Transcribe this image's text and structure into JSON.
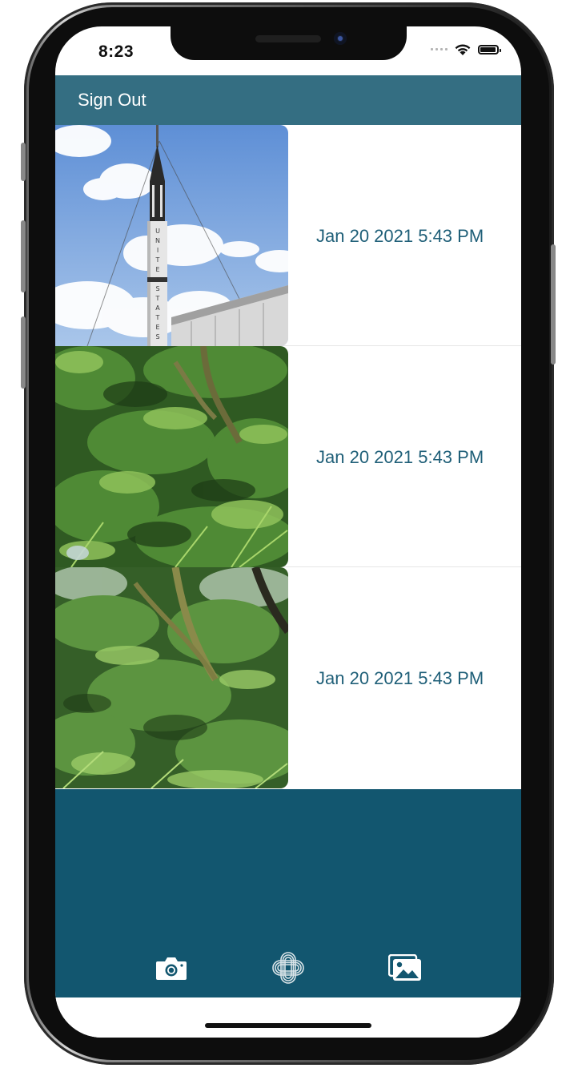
{
  "status_bar": {
    "time": "8:23",
    "icons": [
      "signal-icon",
      "wifi-icon",
      "battery-icon"
    ]
  },
  "header": {
    "sign_out_label": "Sign Out",
    "color": "#346e82"
  },
  "photos": [
    {
      "date": "Jan 20 2021 5:43 PM",
      "thumbnail": "rocket-photo"
    },
    {
      "date": "Jan 20 2021 5:43 PM",
      "thumbnail": "forest-photo"
    },
    {
      "date": "Jan 20 2021 5:43 PM",
      "thumbnail": "forest-photo"
    }
  ],
  "tab_bar": {
    "color": "#12566f",
    "items": [
      {
        "icon": "camera-icon"
      },
      {
        "icon": "app-logo-icon"
      },
      {
        "icon": "gallery-icon"
      }
    ]
  },
  "colors": {
    "date_text": "#1f5f78"
  }
}
